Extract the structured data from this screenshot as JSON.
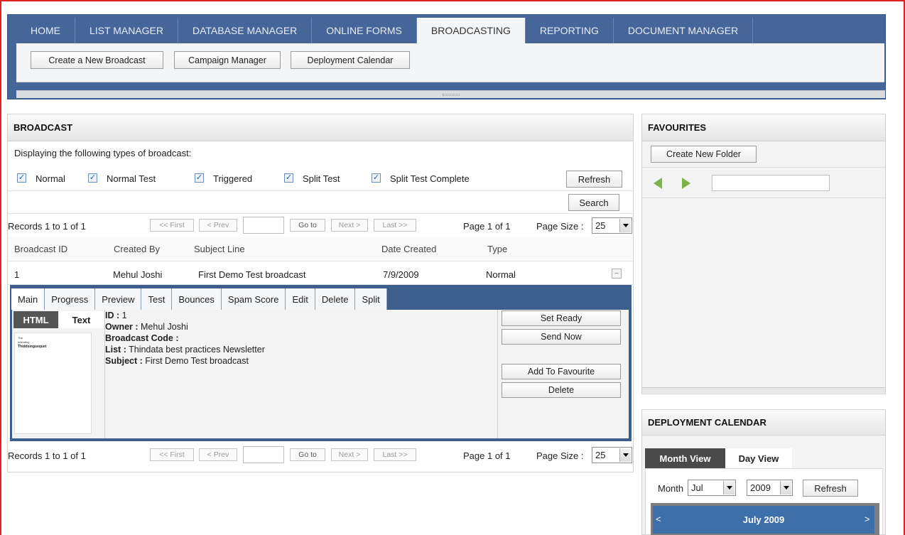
{
  "nav": {
    "tabs": [
      "HOME",
      "LIST MANAGER",
      "DATABASE MANAGER",
      "ONLINE FORMS",
      "BROADCASTING",
      "REPORTING",
      "DOCUMENT MANAGER"
    ],
    "active": "BROADCASTING",
    "sub": [
      "Create a New Broadcast",
      "Campaign Manager",
      "Deployment Calendar"
    ]
  },
  "broadcast": {
    "title": "BROADCAST",
    "intro": "Displaying the following types of broadcast:",
    "types": [
      "Normal",
      "Normal Test",
      "Triggered",
      "Split Test",
      "Split Test Complete"
    ],
    "refresh": "Refresh",
    "search": "Search",
    "pager": {
      "records": "Records 1 to 1 of 1",
      "first": "<< First",
      "prev": "< Prev",
      "goto": "Go to",
      "next": "Next >",
      "last": "Last >>",
      "page": "Page 1 of 1",
      "size_label": "Page Size :",
      "size": "25"
    },
    "columns": [
      "Broadcast ID",
      "Created By",
      "Subject Line",
      "Date Created",
      "Type"
    ],
    "row": {
      "id": "1",
      "created_by": "Mehul Joshi",
      "subject": "First Demo Test broadcast",
      "date": "7/9/2009",
      "type": "Normal"
    },
    "detail_tabs": [
      "Main",
      "Progress",
      "Preview",
      "Test",
      "Bounces",
      "Spam Score",
      "Edit",
      "Delete",
      "Split"
    ],
    "view_tabs": {
      "html": "HTML",
      "text": "Text"
    },
    "thumb_lines": [
      "The",
      "Intending",
      "Thiddsinguequet"
    ],
    "info": [
      {
        "label": "ID :",
        "value": " 1"
      },
      {
        "label": "Owner :",
        "value": " Mehul Joshi"
      },
      {
        "label": "Broadcast Code :",
        "value": ""
      },
      {
        "label": "List :",
        "value": " Thindata best practices Newsletter"
      },
      {
        "label": "Subject :",
        "value": " First Demo Test broadcast"
      }
    ],
    "actions": [
      "Set Ready",
      "Send Now",
      "Add To Favourite",
      "Delete"
    ]
  },
  "favourites": {
    "title": "FAVOURITES",
    "create_folder": "Create New Folder"
  },
  "calendar": {
    "title": "DEPLOYMENT CALENDAR",
    "tabs": [
      "Month View",
      "Day View"
    ],
    "month_label": "Month",
    "month": "Jul",
    "year": "2009",
    "refresh": "Refresh",
    "header": "July 2009",
    "prev": "<",
    "next": ">"
  },
  "colors": {
    "nav_bg": "#46669a",
    "accent_blue": "#3d5f8e",
    "frame_red": "#dd2222",
    "arrow_green": "#7fb34a"
  }
}
